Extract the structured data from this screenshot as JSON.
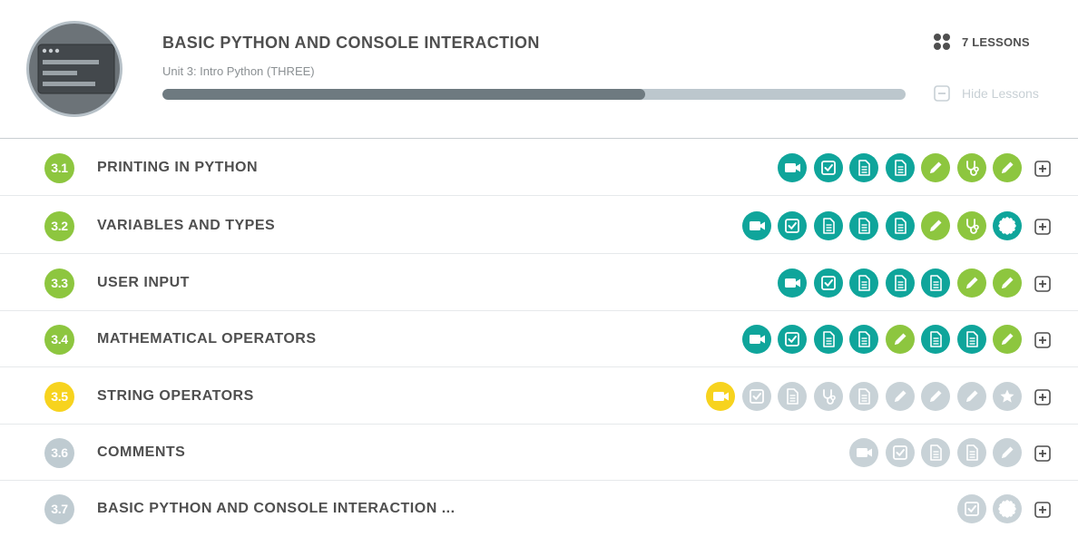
{
  "unit": {
    "title": "BASIC PYTHON AND CONSOLE INTERACTION",
    "subtitle": "Unit 3: Intro Python (THREE)",
    "progress": 0.65,
    "avatar_icon": "browser-window-icon",
    "lesson_count": "7 LESSONS",
    "hide_lessons": "Hide Lessons"
  },
  "colors": {
    "complete": "#8dc63f",
    "current": "#f7d31e",
    "locked": "#bfcbd1",
    "teal": "#0fa59b",
    "green": "#8dc63f",
    "gray": "#c8d2d7",
    "yellow": "#f7d31e"
  },
  "lessons": [
    {
      "number": "3.1",
      "title": "PRINTING IN PYTHON",
      "status": "complete",
      "activities": [
        {
          "icon": "video",
          "state": "teal"
        },
        {
          "icon": "check",
          "state": "teal"
        },
        {
          "icon": "doc",
          "state": "teal"
        },
        {
          "icon": "doc",
          "state": "teal"
        },
        {
          "icon": "pencil",
          "state": "green"
        },
        {
          "icon": "stethoscope",
          "state": "green"
        },
        {
          "icon": "pencil",
          "state": "green"
        }
      ]
    },
    {
      "number": "3.2",
      "title": "VARIABLES AND TYPES",
      "status": "complete",
      "activities": [
        {
          "icon": "video",
          "state": "teal"
        },
        {
          "icon": "check",
          "state": "teal"
        },
        {
          "icon": "doc",
          "state": "teal"
        },
        {
          "icon": "doc",
          "state": "teal"
        },
        {
          "icon": "doc",
          "state": "teal"
        },
        {
          "icon": "pencil",
          "state": "green"
        },
        {
          "icon": "stethoscope",
          "state": "green"
        },
        {
          "icon": "badge",
          "state": "teal"
        }
      ]
    },
    {
      "number": "3.3",
      "title": "USER INPUT",
      "status": "complete",
      "activities": [
        {
          "icon": "video",
          "state": "teal"
        },
        {
          "icon": "check",
          "state": "teal"
        },
        {
          "icon": "doc",
          "state": "teal"
        },
        {
          "icon": "doc",
          "state": "teal"
        },
        {
          "icon": "doc",
          "state": "teal"
        },
        {
          "icon": "pencil",
          "state": "green"
        },
        {
          "icon": "pencil",
          "state": "green"
        }
      ]
    },
    {
      "number": "3.4",
      "title": "MATHEMATICAL OPERATORS",
      "status": "complete",
      "activities": [
        {
          "icon": "video",
          "state": "teal"
        },
        {
          "icon": "check",
          "state": "teal"
        },
        {
          "icon": "doc",
          "state": "teal"
        },
        {
          "icon": "doc",
          "state": "teal"
        },
        {
          "icon": "pencil",
          "state": "green"
        },
        {
          "icon": "doc",
          "state": "teal"
        },
        {
          "icon": "doc",
          "state": "teal"
        },
        {
          "icon": "pencil",
          "state": "green"
        }
      ]
    },
    {
      "number": "3.5",
      "title": "STRING OPERATORS",
      "status": "current",
      "activities": [
        {
          "icon": "video",
          "state": "yellow"
        },
        {
          "icon": "check",
          "state": "gray"
        },
        {
          "icon": "doc",
          "state": "gray"
        },
        {
          "icon": "stethoscope",
          "state": "gray"
        },
        {
          "icon": "doc",
          "state": "gray"
        },
        {
          "icon": "pencil",
          "state": "gray"
        },
        {
          "icon": "pencil",
          "state": "gray"
        },
        {
          "icon": "pencil",
          "state": "gray"
        },
        {
          "icon": "star",
          "state": "gray"
        }
      ]
    },
    {
      "number": "3.6",
      "title": "COMMENTS",
      "status": "locked",
      "activities": [
        {
          "icon": "video",
          "state": "gray"
        },
        {
          "icon": "check",
          "state": "gray"
        },
        {
          "icon": "doc",
          "state": "gray"
        },
        {
          "icon": "doc",
          "state": "gray"
        },
        {
          "icon": "pencil",
          "state": "gray"
        }
      ]
    },
    {
      "number": "3.7",
      "title": "BASIC PYTHON AND CONSOLE INTERACTION ...",
      "status": "locked",
      "activities": [
        {
          "icon": "check",
          "state": "gray"
        },
        {
          "icon": "badge",
          "state": "gray"
        }
      ]
    }
  ]
}
